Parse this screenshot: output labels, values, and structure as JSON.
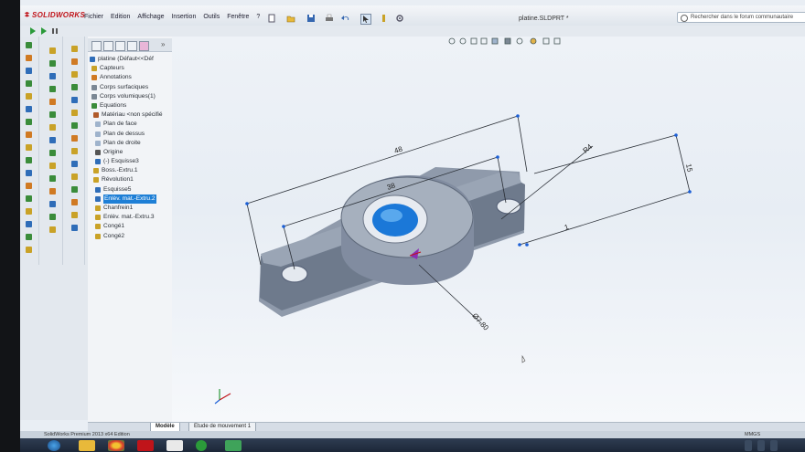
{
  "app": {
    "logo_text": "SOLIDWORKS",
    "document_title": "platine.SLDPRT *",
    "menu": [
      "Fichier",
      "Edition",
      "Affichage",
      "Insertion",
      "Outils",
      "Fenêtre",
      "?"
    ],
    "search_placeholder": "Rechercher dans le forum communautaire"
  },
  "feature_tree": {
    "items": [
      {
        "label": "platine  (Défaut<<Déf",
        "icon": "part-icon"
      },
      {
        "label": "Capteurs",
        "icon": "sensor-icon"
      },
      {
        "label": "Annotations",
        "icon": "annotation-icon"
      },
      {
        "label": "Corps surfaciques",
        "icon": "surface-bodies-icon"
      },
      {
        "label": "Corps volumiques(1)",
        "icon": "solid-bodies-icon"
      },
      {
        "label": "Equations",
        "icon": "equation-icon"
      },
      {
        "label": "Matériau <non spécifié",
        "icon": "material-icon"
      },
      {
        "label": "Plan de face",
        "icon": "plane-icon"
      },
      {
        "label": "Plan de dessus",
        "icon": "plane-icon"
      },
      {
        "label": "Plan de droite",
        "icon": "plane-icon"
      },
      {
        "label": "Origine",
        "icon": "origin-icon"
      },
      {
        "label": "(-) Esquisse3",
        "icon": "sketch-icon"
      },
      {
        "label": "Boss.-Extru.1",
        "icon": "boss-extrude-icon"
      },
      {
        "label": "Révolution1",
        "icon": "revolve-icon"
      },
      {
        "label": "Esquisse5",
        "icon": "sketch-icon"
      },
      {
        "label": "Enlèv. mat.-Extru.2",
        "icon": "cut-extrude-icon"
      },
      {
        "label": "Chanfrein1",
        "icon": "chamfer-icon"
      },
      {
        "label": "Enlèv. mat.-Extru.3",
        "icon": "cut-extrude-icon"
      },
      {
        "label": "Congé1",
        "icon": "fillet-icon"
      },
      {
        "label": "Congé2",
        "icon": "fillet-icon"
      }
    ],
    "selected_index": 15
  },
  "dimensions": {
    "d48": "48",
    "d38": "38",
    "d15": "15",
    "d1": "1",
    "dR4": "R4",
    "dDia": "Ø7.80"
  },
  "bottom_tabs": [
    "Modèle",
    "Etude de mouvement 1"
  ],
  "status": {
    "left": "SolidWorks Premium 2013 x64 Edition",
    "right": "MMGS"
  },
  "colors": {
    "accent": "#1e7fd6",
    "logo": "#c0141a",
    "part": "#8f9aab",
    "bore": "#1b78d8"
  }
}
